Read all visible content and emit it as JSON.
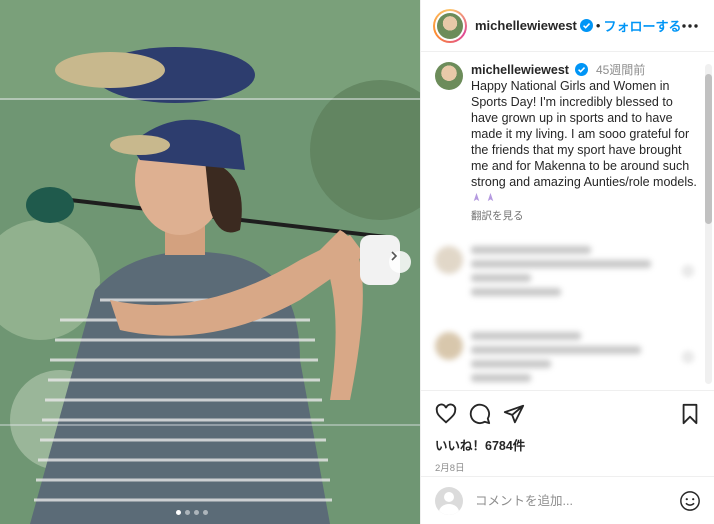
{
  "post": {
    "username": "michellewiewest",
    "follow_label": "フォローする",
    "separator": "•",
    "caption": {
      "username": "michellewiewest",
      "time_ago": "45週間前",
      "text": "Happy National Girls and Women in Sports Day! I'm incredibly blessed to have grown up in sports and to have made it my living. I am sooo grateful for the friends that my sport have brought me and for Makenna to be around such strong and amazing Aunties/role models.",
      "translate_label": "翻訳を見る"
    },
    "likes": "いいね！6784件",
    "date": "2月8日",
    "comment_placeholder": "コメントを追加...",
    "carousel": {
      "current_index": 0,
      "count": 4
    }
  },
  "icons": [
    "verified-badge-icon",
    "more-options-icon",
    "heart-icon",
    "comment-icon",
    "share-icon",
    "bookmark-icon",
    "emoji-icon",
    "chevron-right-icon"
  ],
  "colors": {
    "accent": "#0095f6",
    "text": "#262626",
    "muted": "#8e8e8e",
    "divider": "#efefef"
  }
}
